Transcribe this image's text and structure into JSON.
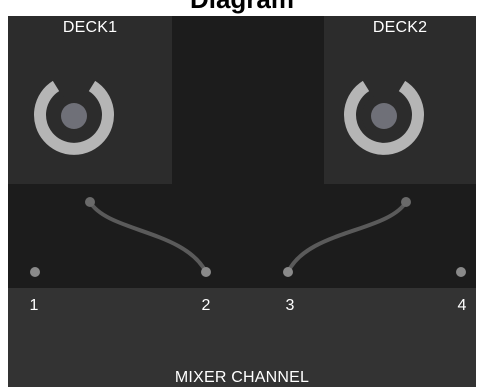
{
  "header": {
    "title": "Diagram"
  },
  "decks": [
    {
      "label": "DECK1",
      "icon": "vinyl-record-icon"
    },
    {
      "label": "DECK2",
      "icon": "vinyl-record-icon"
    }
  ],
  "mixer": {
    "label": "MIXER CHANNEL",
    "ports": [
      "1",
      "2",
      "3",
      "4"
    ]
  },
  "colors": {
    "workspace": "#1c1c1c",
    "deck_panel": "#2c2c2c",
    "mixer_panel": "#333333",
    "icon_ring": "#b5b5b5",
    "icon_center": "#6f7078",
    "cable": "#5a5a5a",
    "port_dot": "#8a8a8a"
  },
  "connections": [
    {
      "from": "DECK1",
      "to": "2"
    },
    {
      "from": "DECK2",
      "to": "3"
    }
  ]
}
